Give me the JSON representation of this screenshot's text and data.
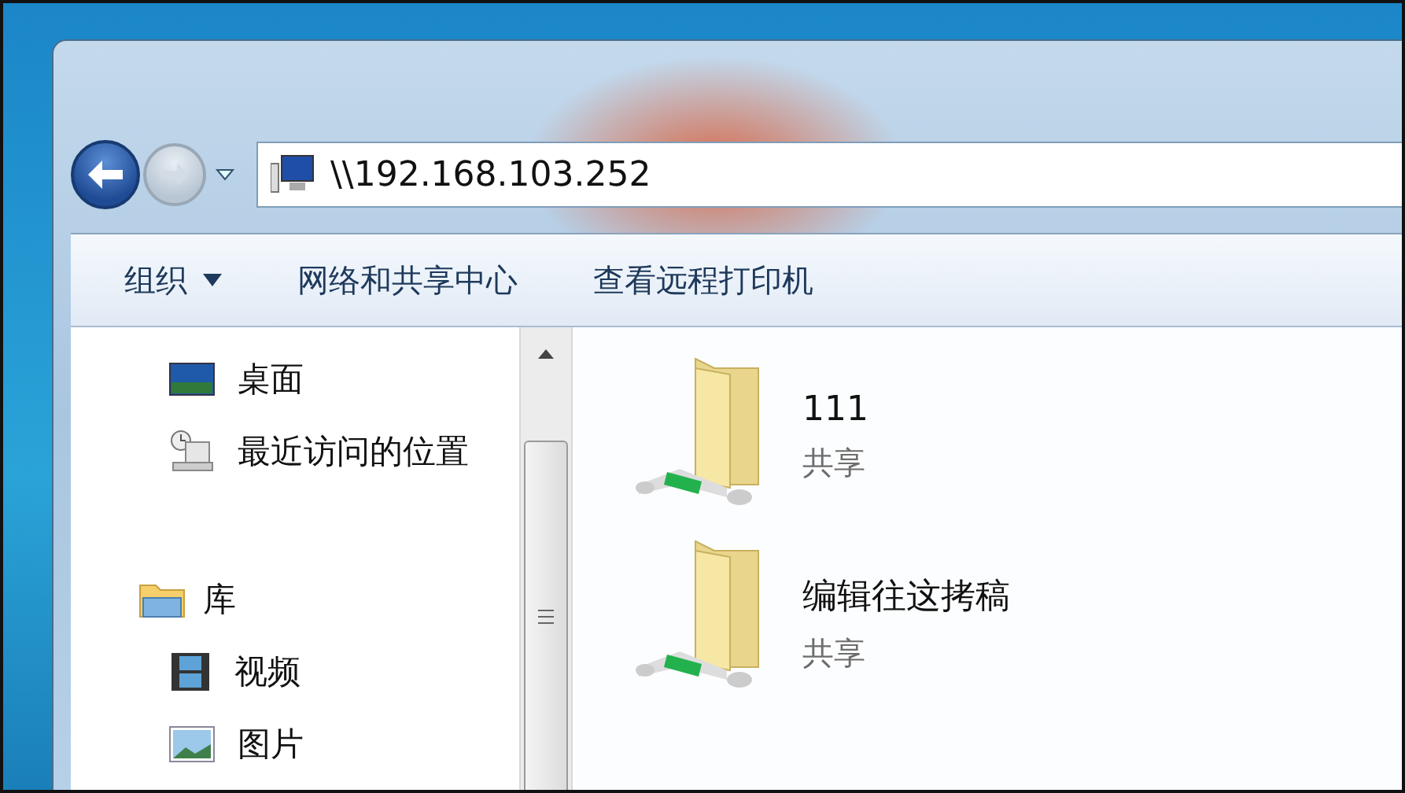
{
  "navigation": {
    "back": {
      "disabled": false
    },
    "forward": {
      "disabled": true
    }
  },
  "address": {
    "value": "\\\\192.168.103.252"
  },
  "toolbar": [
    {
      "label": "组织",
      "kind": "menu"
    },
    {
      "label": "网络和共享中心",
      "kind": "button"
    },
    {
      "label": "查看远程打印机",
      "kind": "button"
    }
  ],
  "sidebar": {
    "items": [
      {
        "label": "桌面",
        "kind": "desktop"
      },
      {
        "label": "最近访问的位置",
        "kind": "recent"
      },
      {
        "label": "库",
        "kind": "library",
        "children": [
          {
            "label": "视频",
            "kind": "video"
          },
          {
            "label": "图片",
            "kind": "pictures"
          }
        ]
      }
    ]
  },
  "items": [
    {
      "name": "111",
      "type": "共享"
    },
    {
      "name": "编辑往这拷稿",
      "type": "共享"
    }
  ]
}
